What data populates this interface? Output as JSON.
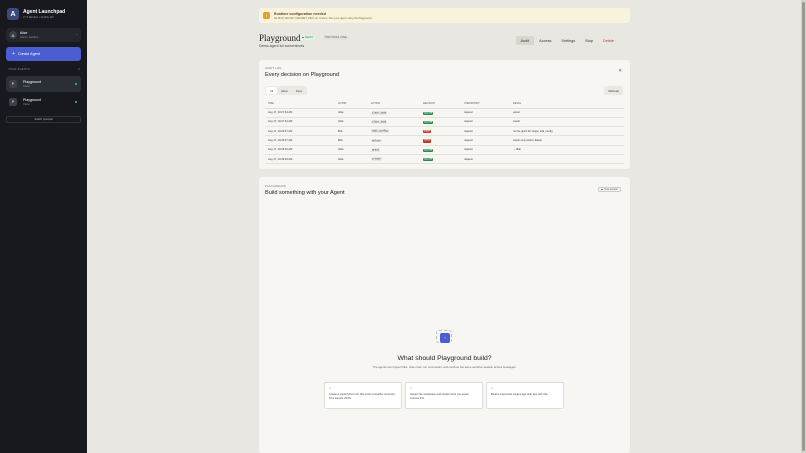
{
  "sidebar": {
    "brand": {
      "logo_letter": "A",
      "name": "Agent Launchpad",
      "subtitle": "3 / 5 Member • Credits 112"
    },
    "user": {
      "avatar_letter": "A",
      "name": "Alice",
      "role": "Admin • Sandbox",
      "chevron": "⌄"
    },
    "create_label": "Create Agent",
    "agents_header": "YOUR AGENTS",
    "agents_count": "2",
    "agents": [
      {
        "letter": "P",
        "name": "Playground",
        "owner": "Owner",
        "status_color": "#3ccf6e"
      },
      {
        "letter": "P",
        "name": "Playground",
        "owner": "Owner",
        "status_color": "#3ccf6e"
      }
    ],
    "switch_label": "Switch principal"
  },
  "banner": {
    "icon": "!",
    "title": "Runtime configuration needed",
    "description": "No MCP, API KEY (SECRET_KEY) on runtime. Run your agent using the Playground."
  },
  "header": {
    "title": "Playground",
    "status_ready": "READY",
    "status_tools": "TWO TOOLS • ONE",
    "subtitle": "Demo agent for screenshots",
    "tabs": [
      {
        "label": "Audit",
        "active": true
      },
      {
        "label": "Access",
        "active": false
      },
      {
        "label": "Settings",
        "active": false
      },
      {
        "label": "Stop",
        "active": false
      },
      {
        "label": "Delete",
        "active": false
      }
    ]
  },
  "audit": {
    "eyebrow": "AUDIT LOG",
    "heading": "Every decision on Playground",
    "close_icon": "✕",
    "filters": [
      "All",
      "Allow",
      "Deny"
    ],
    "active_filter": "All",
    "refresh_label": "Refresh",
    "columns": [
      "TIME",
      "ACTOR",
      "ACTION",
      "DECISION",
      "CHECKPOINT",
      "DETAIL"
    ],
    "rows": [
      {
        "time": "Aug 17, 10:27:43 AM",
        "actor": "Alice",
        "action": "clear_task",
        "decision": "ALLOW",
        "checkpoint": "request",
        "detail": "owner"
      },
      {
        "time": "Aug 17, 10:27:42 AM",
        "actor": "Alice",
        "action": "clear_task",
        "decision": "ALLOW",
        "checkpoint": "request",
        "detail": "owner"
      },
      {
        "time": "Aug 17, 10:26:47 AM",
        "actor": "Bob",
        "action": "edit_config",
        "decision": "DENY",
        "checkpoint": "request",
        "detail": "no live grant for scope: edit_config"
      },
      {
        "time": "Aug 17, 10:26:47 AM",
        "actor": "Bob",
        "action": "delete",
        "decision": "DENY",
        "checkpoint": "request",
        "detail": "owner-only action: delete"
      },
      {
        "time": "Aug 17, 10:26:46 AM",
        "actor": "Alice",
        "action": "grant",
        "decision": "ALLOW",
        "checkpoint": "request",
        "detail": "→ Bob"
      },
      {
        "time": "Aug 17, 10:26:46 AM",
        "actor": "Alice",
        "action": "create",
        "decision": "ALLOW",
        "checkpoint": "request",
        "detail": ""
      }
    ]
  },
  "build": {
    "eyebrow": "PLAYGROUND",
    "heading": "Build something with your Agent",
    "new_session": "New session",
    "art_letter": "⌁",
    "empty_title": "What should Playground build?",
    "empty_desc": "The agents can inspect files, write code, run commands, and continue the same sandbox session across messages.",
    "suggestions": [
      {
        "icon": "◇",
        "text": "Create a small Python CLI that prints a weather summary from sample JSON."
      },
      {
        "icon": "◇",
        "text": "Inspect the workspace and explain what you would improve first."
      },
      {
        "icon": "◇",
        "text": "Build a responsive single-page todo app with Vite."
      }
    ]
  }
}
